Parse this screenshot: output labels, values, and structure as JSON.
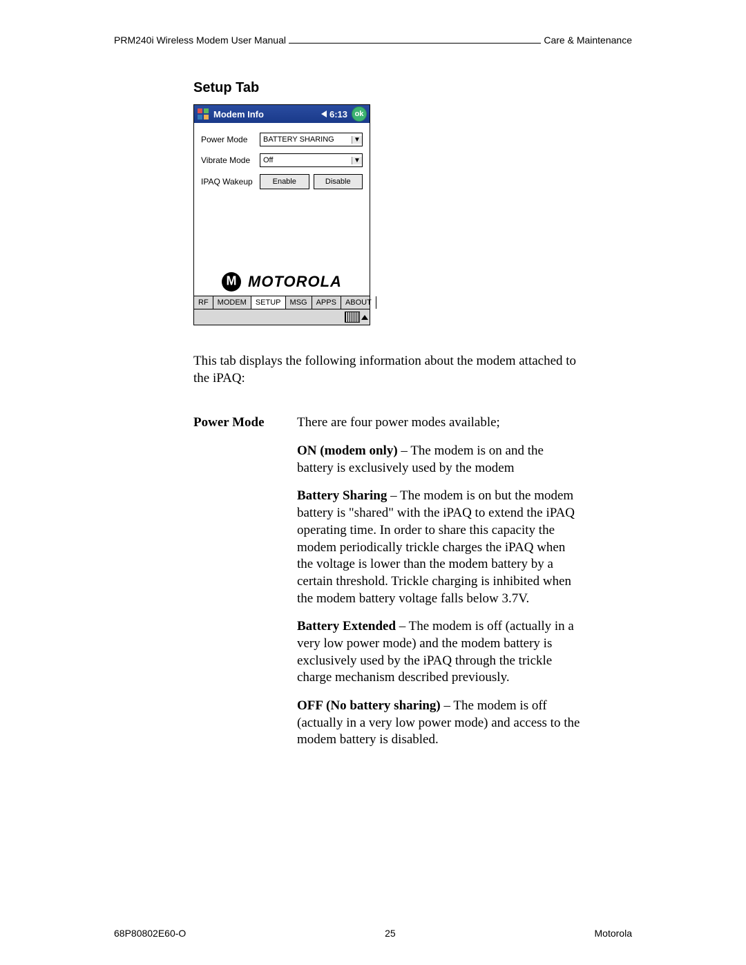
{
  "header": {
    "left": "PRM240i Wireless Modem User Manual",
    "right": "Care & Maintenance"
  },
  "section_title": "Setup Tab",
  "device": {
    "title": "Modem Info",
    "clock": "6:13",
    "ok": "ok",
    "rows": {
      "power_mode_label": "Power Mode",
      "power_mode_value": "BATTERY SHARING",
      "vibrate_mode_label": "Vibrate Mode",
      "vibrate_mode_value": "Off",
      "ipaq_wakeup_label": "IPAQ Wakeup",
      "enable_btn": "Enable",
      "disable_btn": "Disable"
    },
    "brand": "MOTOROLA",
    "tabs": [
      "RF",
      "MODEM",
      "SETUP",
      "MSG",
      "APPS",
      "ABOUT"
    ]
  },
  "body": {
    "intro": "This tab displays the following information about the modem attached to the iPAQ:",
    "power_mode": {
      "label": "Power Mode",
      "lead": "There are four power modes available;",
      "on_bold": "ON (modem only)",
      "on_rest": " – The modem is on and the battery is exclusively used by the modem",
      "share_bold": "Battery Sharing",
      "share_rest": " – The modem is on but the modem battery is \"shared\" with the iPAQ to extend the iPAQ operating time. In order to share this capacity the modem periodically trickle charges the iPAQ when the voltage is lower than the modem battery by a certain threshold. Trickle charging is inhibited when the modem battery voltage falls below 3.7V.",
      "ext_bold": "Battery Extended",
      "ext_rest": " – The modem is off (actually in a very low power mode) and the modem battery is exclusively used by the iPAQ through the trickle charge mechanism described previously.",
      "off_bold": "OFF (No battery sharing)",
      "off_rest": " – The modem is off (actually in a very low power mode) and access to the modem battery is disabled."
    }
  },
  "footer": {
    "left": "68P80802E60-O",
    "center": "25",
    "right": "Motorola"
  }
}
